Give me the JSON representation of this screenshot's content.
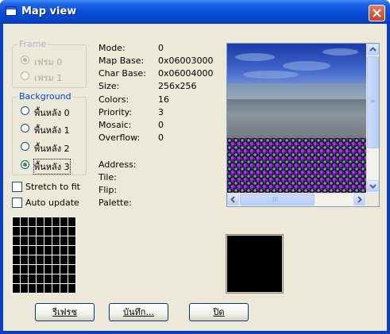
{
  "window": {
    "title": "Map view"
  },
  "frame": {
    "label": "Frame",
    "options": [
      {
        "label": "เฟรม 0",
        "checked": true,
        "disabled": true
      },
      {
        "label": "เฟรม 1",
        "checked": false,
        "disabled": true
      }
    ]
  },
  "background": {
    "label": "Background",
    "options": [
      {
        "label": "พื้นหลัง 0",
        "checked": false
      },
      {
        "label": "พื้นหลัง 1",
        "checked": false
      },
      {
        "label": "พื้นหลัง 2",
        "checked": false
      },
      {
        "label": "พื้นหลัง 3",
        "checked": true
      }
    ]
  },
  "stretch": {
    "label": "Stretch to fit",
    "checked": false
  },
  "auto_update": {
    "label": "Auto update",
    "checked": false
  },
  "info": {
    "mode": {
      "label": "Mode:",
      "value": "0"
    },
    "map_base": {
      "label": "Map Base:",
      "value": "0x06003000"
    },
    "char_base": {
      "label": "Char Base:",
      "value": "0x06004000"
    },
    "size": {
      "label": "Size:",
      "value": "256x256"
    },
    "colors": {
      "label": "Colors:",
      "value": "16"
    },
    "priority": {
      "label": "Priority:",
      "value": "3"
    },
    "mosaic": {
      "label": "Mosaic:",
      "value": "0"
    },
    "overflow": {
      "label": "Overflow:",
      "value": "0"
    },
    "address": {
      "label": "Address:"
    },
    "tile": {
      "label": "Tile:"
    },
    "flip": {
      "label": "Flip:"
    },
    "palette": {
      "label": "Palette:"
    }
  },
  "buttons": {
    "refresh": "รีเฟรช",
    "save": "บันทึก...",
    "close": "ปิด"
  },
  "scrollbar_grip": "III",
  "colors": {
    "title_bar": "#0a4fd8",
    "dialog_bg": "#ece9d8",
    "group_label": "#0046d5",
    "radio_selected": "#21a121"
  }
}
